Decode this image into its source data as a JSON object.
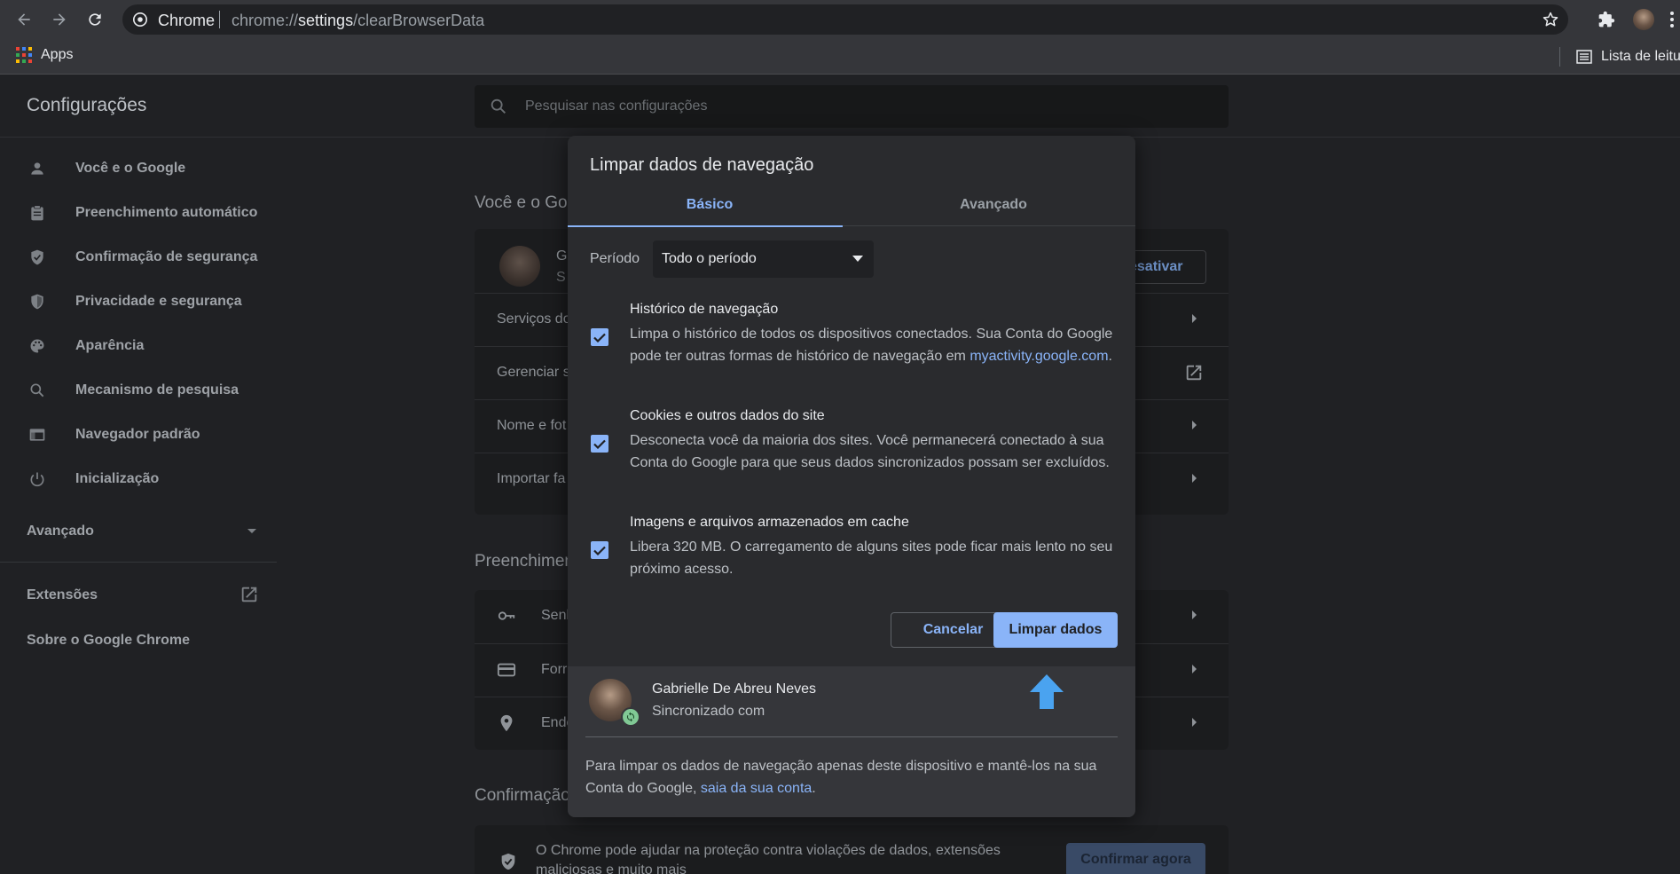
{
  "browser": {
    "site_label": "Chrome",
    "url_scheme": "chrome://",
    "url_host": "settings",
    "url_path": "/clearBrowserData",
    "bookmarks": {
      "apps_label": "Apps",
      "reading_list_label": "Lista de leitur"
    }
  },
  "settings": {
    "title": "Configurações",
    "search_placeholder": "Pesquisar nas configurações",
    "nav": [
      {
        "label": "Você e o Google",
        "icon": "person-icon"
      },
      {
        "label": "Preenchimento automático",
        "icon": "clipboard-icon"
      },
      {
        "label": "Confirmação de segurança",
        "icon": "shield-check-icon"
      },
      {
        "label": "Privacidade e segurança",
        "icon": "shield-half-icon"
      },
      {
        "label": "Aparência",
        "icon": "palette-icon"
      },
      {
        "label": "Mecanismo de pesquisa",
        "icon": "search-icon"
      },
      {
        "label": "Navegador padrão",
        "icon": "browser-window-icon"
      },
      {
        "label": "Inicialização",
        "icon": "power-icon"
      }
    ],
    "advanced_label": "Avançado",
    "extensions_label": "Extensões",
    "about_label": "Sobre o Google Chrome"
  },
  "background": {
    "section_you": "Você e o Goo",
    "profile_initial": "G",
    "profile_sub": "S",
    "deactivate": "esativar",
    "rows_you": [
      "Serviços do",
      "Gerenciar s",
      "Nome e fot",
      "Importar fa"
    ],
    "section_autofill": "Preenchimen",
    "rows_autofill": [
      "Senh",
      "Forr",
      "Ende"
    ],
    "section_safety": "Confirmação",
    "safety_text": "O Chrome pode ajudar na proteção contra violações de dados, extensões maliciosas e muito mais",
    "safety_button": "Confirmar agora"
  },
  "dialog": {
    "title": "Limpar dados de navegação",
    "tabs": {
      "basic": "Básico",
      "advanced": "Avançado"
    },
    "period_label": "Período",
    "period_value": "Todo o período",
    "options": [
      {
        "title": "Histórico de navegação",
        "desc": "Limpa o histórico de todos os dispositivos conectados. Sua Conta do Google pode ter outras formas de histórico de navegação em ",
        "link": "myactivity.google.com",
        "after": ".",
        "checked": true
      },
      {
        "title": "Cookies e outros dados do site",
        "desc": "Desconecta você da maioria dos sites. Você permanecerá conectado à sua Conta do Google para que seus dados sincronizados possam ser excluídos.",
        "checked": true
      },
      {
        "title": "Imagens e arquivos armazenados em cache",
        "desc": "Libera 320 MB. O carregamento de alguns sites pode ficar mais lento no seu próximo acesso.",
        "checked": true
      }
    ],
    "cancel": "Cancelar",
    "confirm": "Limpar dados",
    "account_name": "Gabrielle De Abreu Neves",
    "account_status": "Sincronizado com",
    "note_text": "Para limpar os dados de navegação apenas deste dispositivo e mantê-los na sua Conta do Google, ",
    "note_link": "saia da sua conta",
    "note_end": "."
  },
  "colors": {
    "accent": "#8ab4f8",
    "background": "#202124",
    "dialog": "#2a2b2e",
    "annotation_arrow": "#4aa3f0"
  }
}
